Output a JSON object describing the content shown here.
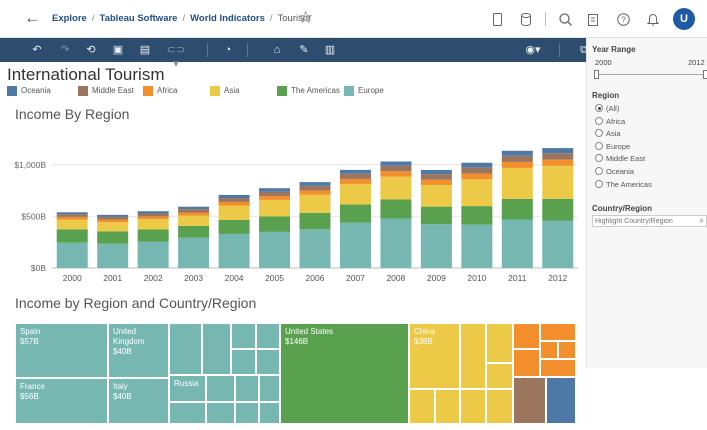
{
  "breadcrumb": {
    "back_icon": "arrow-left-icon",
    "items": [
      "Explore",
      "Tableau Software",
      "World Indicators"
    ],
    "current": "Tourism",
    "favorite_icon": "star-icon"
  },
  "nav_icons": [
    "device-preview-icon",
    "data-source-icon",
    "search-icon",
    "new-workbook-icon",
    "help-icon",
    "notifications-icon"
  ],
  "user": {
    "avatar_initial": "U",
    "avatar_color": "#1f5aa6"
  },
  "toolbar": {
    "left_icons": [
      "undo-icon",
      "redo-icon",
      "revert-icon",
      "save-icon",
      "new-datasource-icon",
      "toggle-icon",
      "pause-updates-icon",
      "refresh-data-icon",
      "show-me-icon",
      "data-guide-icon"
    ],
    "right_icons": [
      "view-mode-icon",
      "duplicate-icon",
      "presentation-icon",
      "device-layout-icon",
      "share-icon"
    ]
  },
  "dashboard": {
    "title": "International Tourism",
    "legend": [
      {
        "label": "Oceania",
        "color": "#4e79a7"
      },
      {
        "label": "Middle East",
        "color": "#9c755f"
      },
      {
        "label": "Africa",
        "color": "#f28e2b"
      },
      {
        "label": "Asia",
        "color": "#edc948"
      },
      {
        "label": "The Americas",
        "color": "#59a14f"
      },
      {
        "label": "Europe",
        "color": "#76b7b2"
      }
    ],
    "bar_section_title": "Income By Region",
    "treemap_section_title": "Income by Region and Country/Region"
  },
  "chart_data": {
    "type": "bar",
    "stacked": true,
    "title": "Income By Region",
    "categories": [
      "2000",
      "2001",
      "2002",
      "2003",
      "2004",
      "2005",
      "2006",
      "2007",
      "2008",
      "2009",
      "2010",
      "2011",
      "2012"
    ],
    "y_tick_labels": [
      "$0B",
      "$500B",
      "$1,000B"
    ],
    "y_ticks": [
      0,
      500,
      1000
    ],
    "ylim": [
      0,
      1300
    ],
    "grid": true,
    "series": [
      {
        "name": "Europe",
        "color": "#76b7b2",
        "values": [
          245,
          235,
          255,
          295,
          330,
          350,
          375,
          440,
          480,
          425,
          420,
          470,
          460
        ]
      },
      {
        "name": "The Americas",
        "color": "#59a14f",
        "values": [
          130,
          120,
          118,
          113,
          135,
          150,
          160,
          175,
          185,
          170,
          180,
          200,
          210
        ]
      },
      {
        "name": "Asia",
        "color": "#edc948",
        "values": [
          95,
          90,
          100,
          100,
          140,
          160,
          175,
          200,
          220,
          210,
          260,
          300,
          320
        ]
      },
      {
        "name": "Africa",
        "color": "#f28e2b",
        "values": [
          25,
          25,
          27,
          30,
          35,
          38,
          42,
          48,
          52,
          50,
          55,
          58,
          60
        ]
      },
      {
        "name": "Middle East",
        "color": "#9c755f",
        "values": [
          25,
          25,
          28,
          32,
          38,
          42,
          45,
          50,
          55,
          55,
          60,
          60,
          62
        ]
      },
      {
        "name": "Oceania",
        "color": "#4e79a7",
        "values": [
          20,
          20,
          22,
          24,
          30,
          33,
          35,
          38,
          40,
          40,
          45,
          48,
          50
        ]
      }
    ]
  },
  "treemap": {
    "labeled": [
      {
        "country": "Spain",
        "value": "$57B"
      },
      {
        "country": "United Kingdom",
        "value": "$40B"
      },
      {
        "country": "France",
        "value": "$56B"
      },
      {
        "country": "Italy",
        "value": "$40B"
      },
      {
        "country": "Russia",
        "value": ""
      },
      {
        "country": "United States",
        "value": "$146B"
      },
      {
        "country": "China",
        "value": "$38B"
      }
    ]
  },
  "filters": {
    "year_range": {
      "title": "Year Range",
      "min_label": "2000",
      "max_label": "2012",
      "low": 2000,
      "high": 2012
    },
    "region": {
      "title": "Region",
      "options": [
        "(All)",
        "Africa",
        "Asia",
        "Europe",
        "Middle East",
        "Oceania",
        "The Americas"
      ],
      "selected": "(All)"
    },
    "country": {
      "title": "Country/Region",
      "placeholder": "Highlight Country/Region",
      "search_icon": "search-icon"
    }
  }
}
